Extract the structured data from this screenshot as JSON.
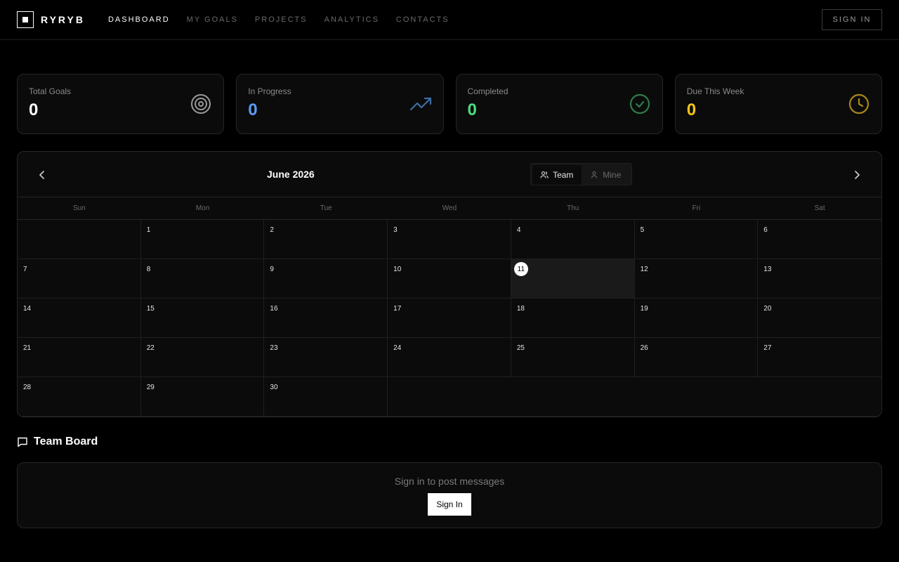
{
  "nav": {
    "brand": "RYRYB",
    "links": [
      {
        "label": "DASHBOARD",
        "active": true
      },
      {
        "label": "MY GOALS",
        "active": false
      },
      {
        "label": "PROJECTS",
        "active": false
      },
      {
        "label": "ANALYTICS",
        "active": false
      },
      {
        "label": "CONTACTS",
        "active": false
      }
    ],
    "sign_in": "SIGN IN"
  },
  "stats": [
    {
      "label": "Total Goals",
      "value": "0",
      "color": "#ffffff",
      "icon": "target-icon",
      "icon_color": "#9a9a9a"
    },
    {
      "label": "In Progress",
      "value": "0",
      "color": "#5b9cf5",
      "icon": "trending-up-icon",
      "icon_color": "#3b6ea8"
    },
    {
      "label": "Completed",
      "value": "0",
      "color": "#4ade80",
      "icon": "check-circle-icon",
      "icon_color": "#2f7a4a"
    },
    {
      "label": "Due This Week",
      "value": "0",
      "color": "#f5c518",
      "icon": "clock-icon",
      "icon_color": "#a8861a"
    }
  ],
  "calendar": {
    "title": "June 2026",
    "toggle": {
      "team": "Team",
      "mine": "Mine",
      "selected": "team"
    },
    "weekdays": [
      "Sun",
      "Mon",
      "Tue",
      "Wed",
      "Thu",
      "Fri",
      "Sat"
    ],
    "first_weekday_index": 1,
    "days_in_month": 30,
    "today": 11
  },
  "team_board": {
    "title": "Team Board",
    "message": "Sign in to post messages",
    "button": "Sign In"
  }
}
